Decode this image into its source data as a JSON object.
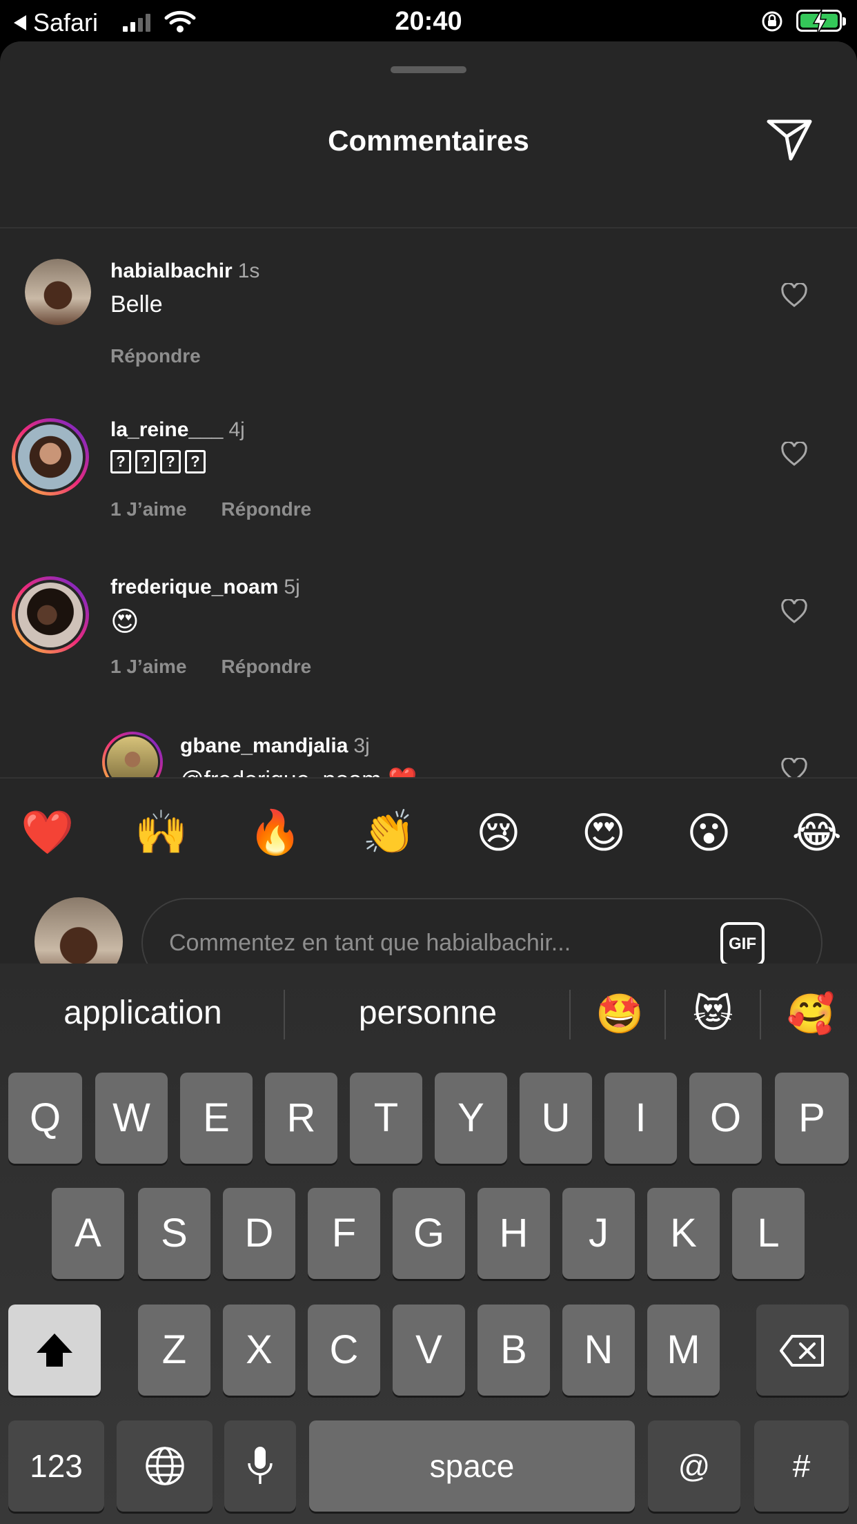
{
  "status_bar": {
    "back_label": "Safari",
    "time": "20:40",
    "battery_color": "#34c759"
  },
  "sheet": {
    "title": "Commentaires",
    "send_icon": "paper-plane-icon"
  },
  "comments": [
    {
      "username": "habialbachir",
      "ago": "1s",
      "text": "Belle",
      "likes": "",
      "reply": "Répondre"
    },
    {
      "username": "la_reine___",
      "ago": "4j",
      "text": "????",
      "likes": "1 J’aime",
      "reply": "Répondre"
    },
    {
      "username": "frederique_noam",
      "ago": "5j",
      "text": "😍",
      "likes": "1 J’aime",
      "reply": "Répondre"
    },
    {
      "username": "gbane_mandjalia",
      "ago": "3j",
      "text": "@frederique_noam ❤️",
      "likes": "",
      "reply": ""
    }
  ],
  "quick_emojis": [
    "❤️",
    "🙌",
    "🔥",
    "👏",
    "😢",
    "😍",
    "😮",
    "😂"
  ],
  "composer": {
    "placeholder": "Commentez en tant que habialbachir...",
    "gif_label": "GIF"
  },
  "keyboard": {
    "predictions": [
      "application",
      "personne"
    ],
    "prediction_emojis": [
      "🤩",
      "😻",
      "🥰"
    ],
    "row1": [
      "Q",
      "W",
      "E",
      "R",
      "T",
      "Y",
      "U",
      "I",
      "O",
      "P"
    ],
    "row2": [
      "A",
      "S",
      "D",
      "F",
      "G",
      "H",
      "J",
      "K",
      "L"
    ],
    "row3": [
      "Z",
      "X",
      "C",
      "V",
      "B",
      "N",
      "M"
    ],
    "numbers_label": "123",
    "space_label": "space",
    "at_label": "@",
    "hash_label": "#"
  }
}
